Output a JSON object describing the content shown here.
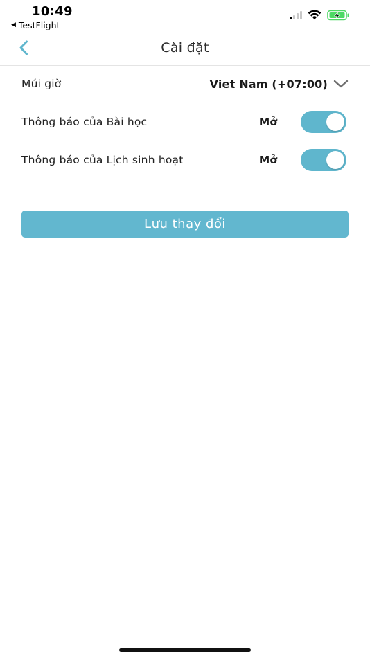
{
  "status_bar": {
    "time": "10:49",
    "back_app": "TestFlight",
    "back_arrow": "◀"
  },
  "header": {
    "title": "Cài đặt",
    "back_icon": "chevron-left-icon"
  },
  "settings": {
    "timezone": {
      "label": "Múi giờ",
      "value": "Viet Nam (+07:00)"
    },
    "lesson_notifications": {
      "label": "Thông báo của Bài học",
      "status": "Mở",
      "enabled": true
    },
    "schedule_notifications": {
      "label": "Thông báo của Lịch sinh hoạt",
      "status": "Mở",
      "enabled": true
    }
  },
  "save_button": {
    "label": "Lưu thay đổi"
  },
  "colors": {
    "accent": "#5fb6cd",
    "button": "#62b7cf",
    "divider": "#e4e4e4",
    "battery": "#4cd964"
  }
}
